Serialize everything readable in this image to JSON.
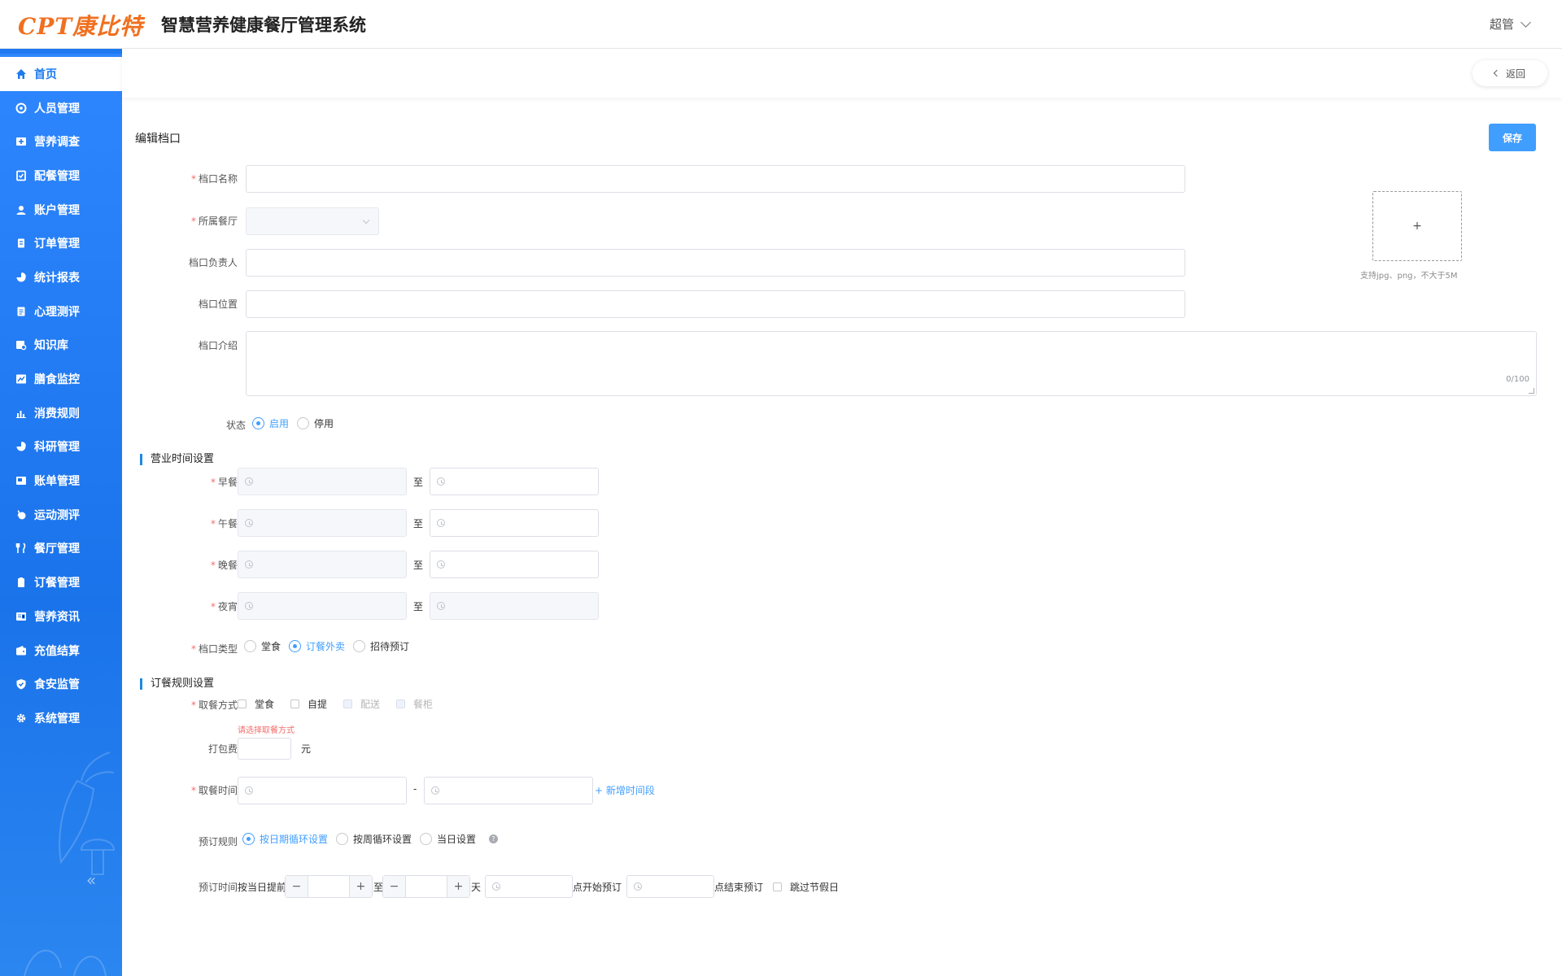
{
  "header": {
    "logo_text": "CPT康比特",
    "app_title": "智慧营养健康餐厅管理系统",
    "user_name": "超管"
  },
  "sidebar": {
    "items": [
      {
        "label": "首页",
        "icon": "home-icon",
        "active": true
      },
      {
        "label": "人员管理",
        "icon": "people-icon"
      },
      {
        "label": "营养调查",
        "icon": "survey-icon"
      },
      {
        "label": "配餐管理",
        "icon": "meal-plan-icon"
      },
      {
        "label": "账户管理",
        "icon": "account-icon"
      },
      {
        "label": "订单管理",
        "icon": "order-icon"
      },
      {
        "label": "统计报表",
        "icon": "pie-chart-icon"
      },
      {
        "label": "心理测评",
        "icon": "document-icon"
      },
      {
        "label": "知识库",
        "icon": "knowledge-icon"
      },
      {
        "label": "膳食监控",
        "icon": "line-chart-icon"
      },
      {
        "label": "消费规则",
        "icon": "bar-chart-icon"
      },
      {
        "label": "科研管理",
        "icon": "pie-chart-icon"
      },
      {
        "label": "账单管理",
        "icon": "bill-icon"
      },
      {
        "label": "运动测评",
        "icon": "sport-icon"
      },
      {
        "label": "餐厅管理",
        "icon": "cutlery-icon"
      },
      {
        "label": "订餐管理",
        "icon": "clipboard-icon"
      },
      {
        "label": "营养资讯",
        "icon": "news-icon"
      },
      {
        "label": "充值结算",
        "icon": "wallet-icon"
      },
      {
        "label": "食安监管",
        "icon": "shield-check-icon"
      },
      {
        "label": "系统管理",
        "icon": "gear-icon"
      }
    ]
  },
  "topbar": {
    "back_label": "返回"
  },
  "form": {
    "page_title": "编辑档口",
    "save_label": "保存",
    "fields": {
      "stall_name_label": "档口名称",
      "stall_name_value": "",
      "restaurant_label": "所属餐厅",
      "restaurant_value": "",
      "manager_label": "档口负责人",
      "manager_value": "",
      "location_label": "档口位置",
      "location_value": "",
      "intro_label": "档口介绍",
      "intro_counter": "0/100",
      "status_label": "状态",
      "status_options": [
        "启用",
        "停用"
      ],
      "status_selected": "启用"
    },
    "upload": {
      "plus": "+",
      "tip": "支持jpg、png，不大于5M"
    }
  },
  "business_hours": {
    "section_title": "营业时间设置",
    "to_text": "至",
    "rows": [
      {
        "label": "早餐"
      },
      {
        "label": "午餐"
      },
      {
        "label": "晚餐"
      },
      {
        "label": "夜宵"
      }
    ],
    "stall_type_label": "档口类型",
    "stall_type_options": [
      "堂食",
      "订餐外卖",
      "招待预订"
    ],
    "stall_type_selected": "订餐外卖"
  },
  "order_rules": {
    "section_title": "订餐规则设置",
    "pickup_method_label": "取餐方式",
    "pickup_methods": [
      {
        "label": "堂食",
        "disabled": false
      },
      {
        "label": "自提",
        "disabled": false
      },
      {
        "label": "配送",
        "disabled": true
      },
      {
        "label": "餐柜",
        "disabled": true
      }
    ],
    "pickup_error": "请选择取餐方式",
    "packing_fee_label": "打包费",
    "packing_fee_unit": "元",
    "pickup_time_label": "取餐时间",
    "pickup_time_sep": "-",
    "add_period_label": "新增时间段",
    "booking_rule_label": "预订规则",
    "booking_rule_options": [
      "按日期循环设置",
      "按周循环设置",
      "当日设置"
    ],
    "booking_rule_selected": "按日期循环设置",
    "booking_time_label": "预订时间",
    "booking_time_prefix": "按当日提前",
    "booking_time_to": "至",
    "booking_time_day": "天",
    "booking_start_suffix": "点开始预订",
    "booking_end_suffix": "点结束预订",
    "skip_holiday_label": "跳过节假日",
    "stepper_minus": "−",
    "stepper_plus": "+"
  }
}
